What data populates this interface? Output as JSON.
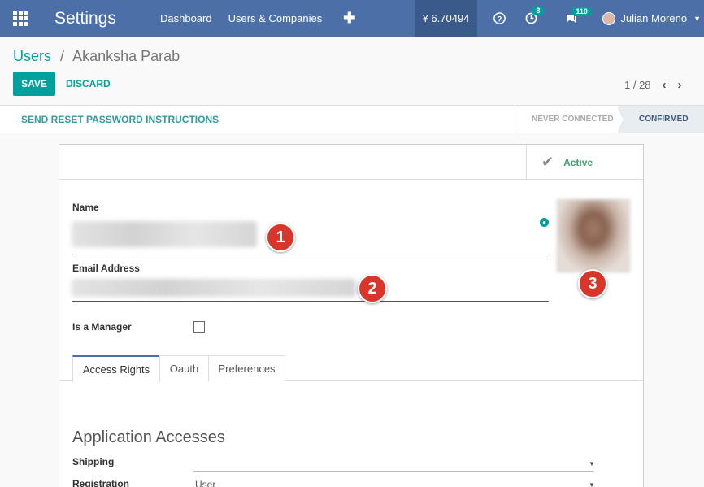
{
  "navbar": {
    "brand": "Settings",
    "links": [
      "Dashboard",
      "Users & Companies"
    ],
    "plus_icon": "plus-icon",
    "currency": "¥ 6.70494",
    "help_icon": "question-circle-icon",
    "activity_count": "8",
    "messages_count": "110",
    "user_name": "Julian Moreno",
    "accent": "#4c6fa8"
  },
  "breadcrumb": {
    "root": "Users",
    "separator": "/",
    "current": "Akanksha Parab"
  },
  "actions": {
    "save": "SAVE",
    "discard": "DISCARD"
  },
  "pager": {
    "value": "1 / 28"
  },
  "statusbar": {
    "reset_link": "SEND RESET PASSWORD INSTRUCTIONS",
    "stages": [
      "NEVER CONNECTED",
      "CONFIRMED"
    ],
    "current_stage": "CONFIRMED"
  },
  "sheet": {
    "active_label": "Active",
    "name_label": "Name",
    "email_label": "Email Address",
    "manager_label": "Is a Manager",
    "manager_checked": false,
    "markers": [
      "1",
      "2",
      "3"
    ],
    "tabs": [
      "Access Rights",
      "Oauth",
      "Preferences"
    ],
    "active_tab": "Access Rights",
    "section_title": "Application Accesses",
    "access_rows": [
      {
        "label": "Shipping",
        "value": ""
      },
      {
        "label": "Registration",
        "value": "User"
      }
    ]
  },
  "colors": {
    "primary": "#00a09d",
    "marker": "#d9362b"
  }
}
